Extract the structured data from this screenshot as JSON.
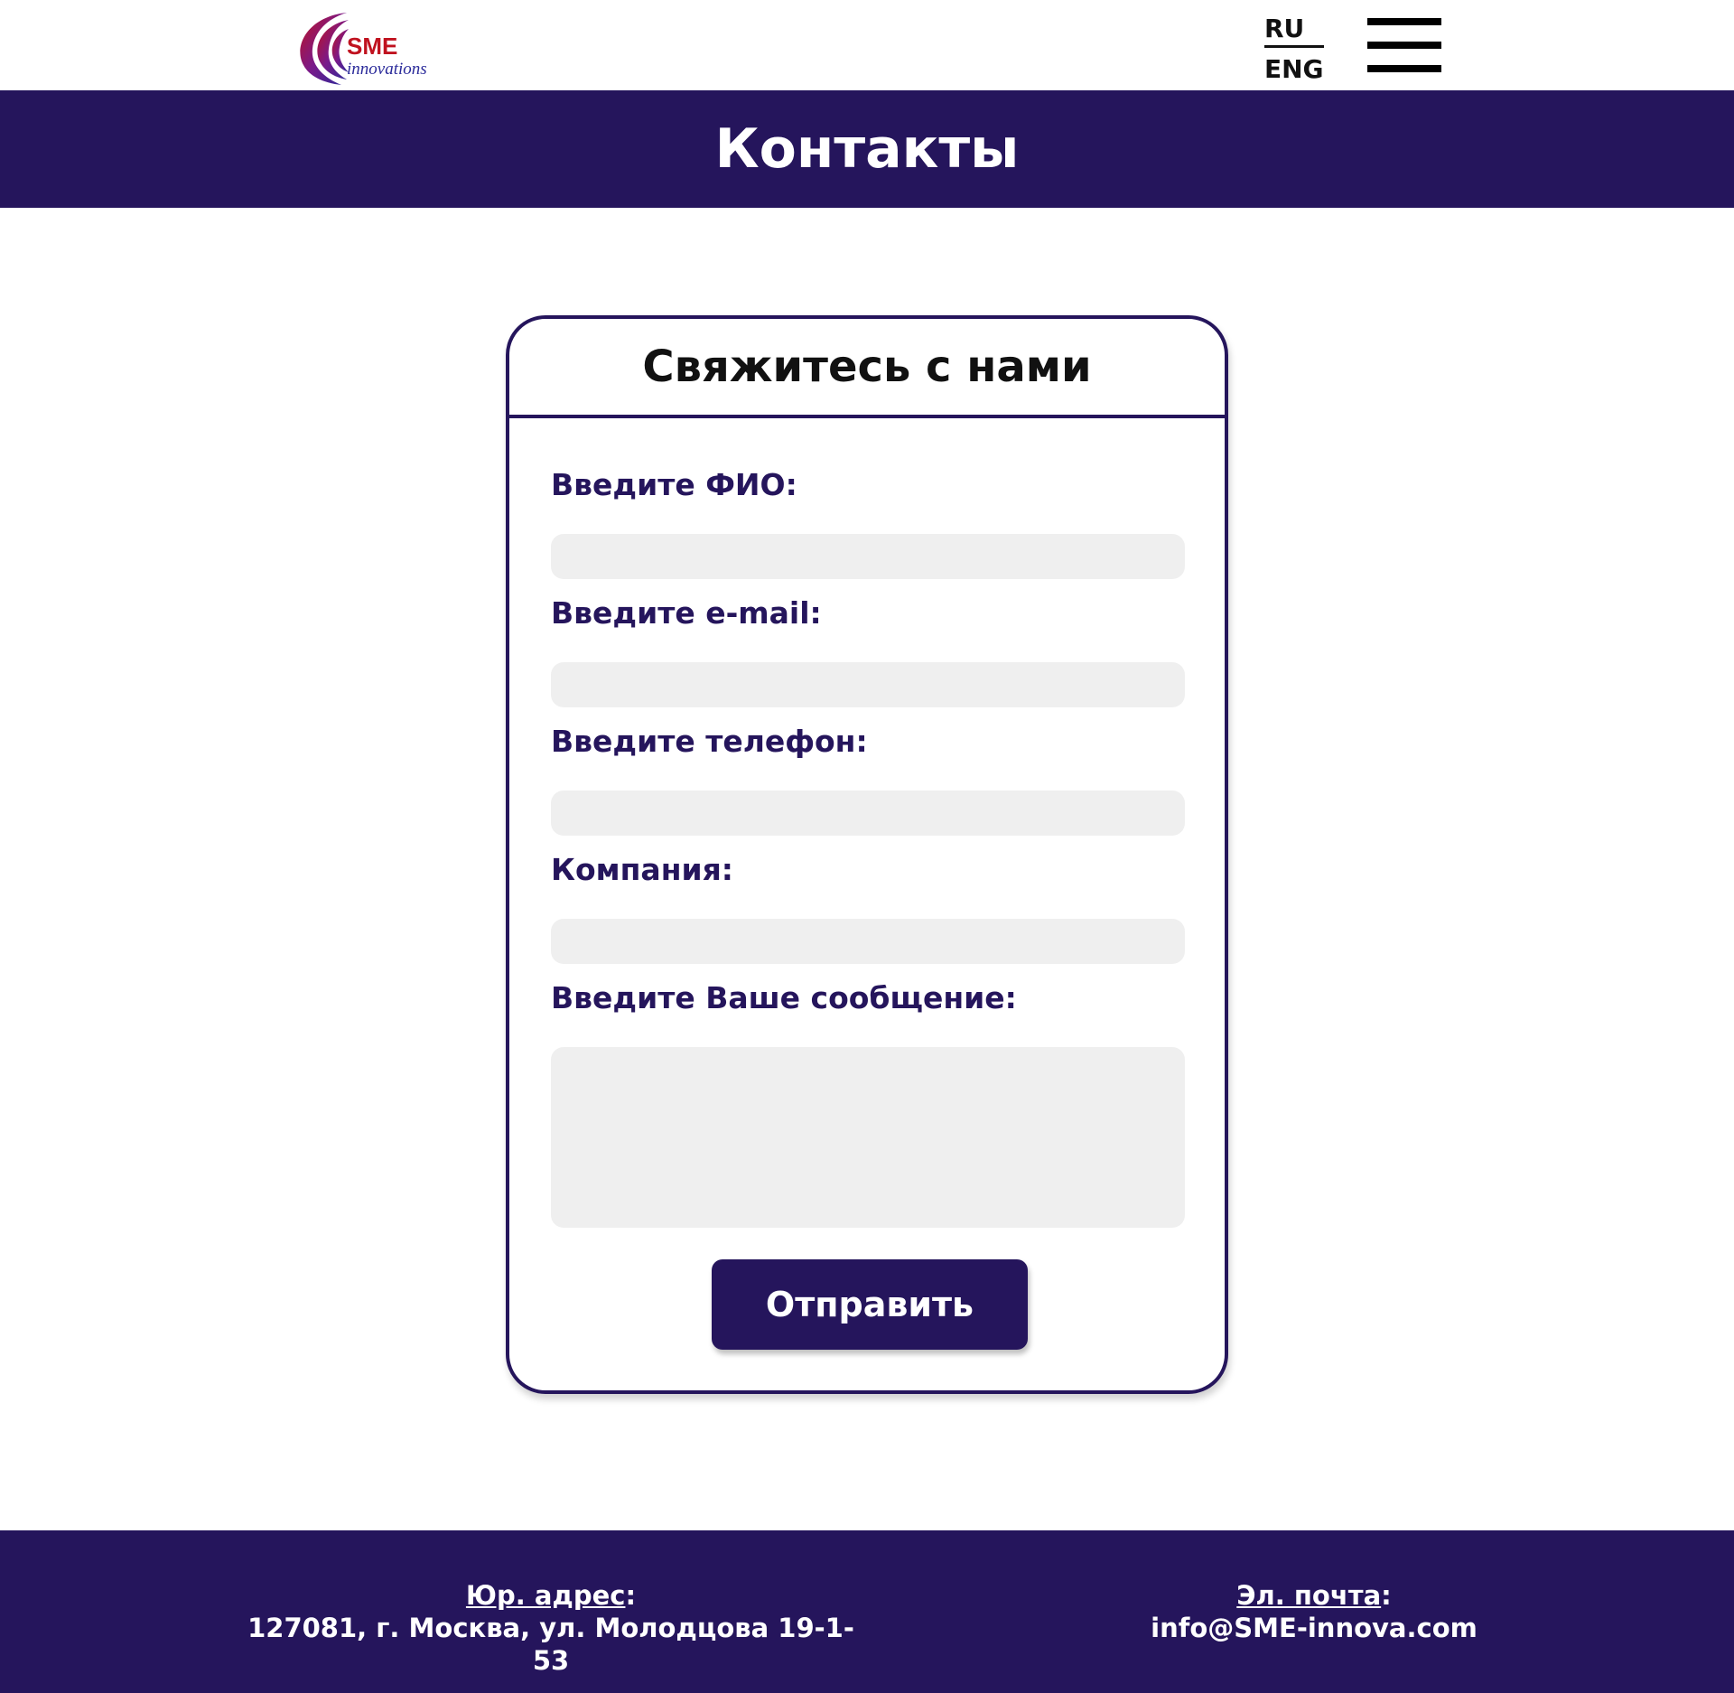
{
  "header": {
    "logo": {
      "brand": "SME",
      "tagline": "innovations"
    },
    "lang": {
      "ru": "RU",
      "eng": "ENG"
    }
  },
  "banner": {
    "title": "Контакты"
  },
  "form": {
    "title": "Свяжитесь с нами",
    "fields": [
      {
        "label": "Введите ФИО:",
        "value": ""
      },
      {
        "label": "Введите e-mail:",
        "value": ""
      },
      {
        "label": "Введите телефон:",
        "value": ""
      },
      {
        "label": "Компания:",
        "value": ""
      },
      {
        "label": "Введите Ваше сообщение:",
        "value": ""
      }
    ],
    "submit_label": "Отправить"
  },
  "footer": {
    "address_title": "Юр. адрес",
    "address_colon": ":",
    "address_value": "127081, г. Москва, ул. Молодцова 19-1-53",
    "email_title": "Эл. почта",
    "email_colon": ":",
    "email_value": "info@SME-innova.com"
  },
  "colors": {
    "primary": "#25155c",
    "input_bg": "#efefef",
    "logo_red": "#c0121f",
    "logo_blue": "#2a2a9a"
  },
  "icons": {
    "menu": "hamburger-menu-icon"
  }
}
